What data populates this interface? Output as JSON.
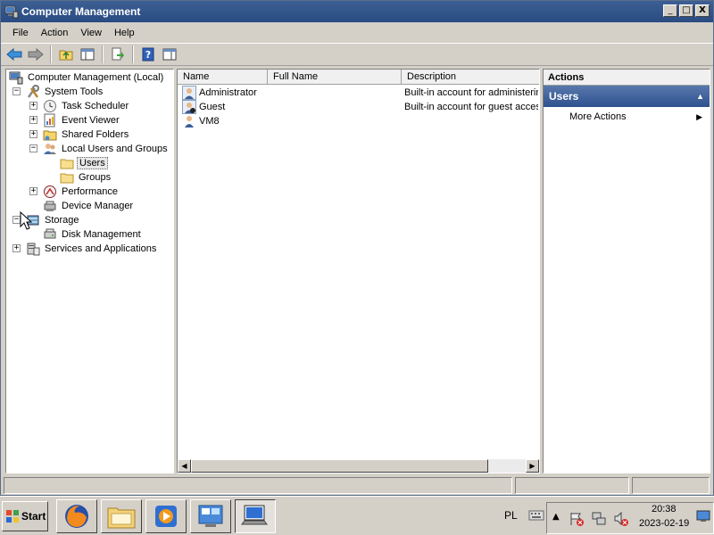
{
  "window": {
    "title": "Computer Management",
    "controls": {
      "minimize": "_",
      "maximize": "□",
      "close": "X"
    }
  },
  "menu": [
    "File",
    "Action",
    "View",
    "Help"
  ],
  "toolbar": [
    "back-arrow-icon",
    "forward-arrow-icon",
    "up-folder-icon",
    "show-hide-console-tree-icon",
    "export-list-icon",
    "help-icon",
    "show-hide-action-pane-icon"
  ],
  "tree": {
    "root": "Computer Management (Local)",
    "system_tools": "System Tools",
    "task_scheduler": "Task Scheduler",
    "event_viewer": "Event Viewer",
    "shared_folders": "Shared Folders",
    "local_users_groups": "Local Users and Groups",
    "users": "Users",
    "groups": "Groups",
    "performance": "Performance",
    "device_manager": "Device Manager",
    "storage": "Storage",
    "disk_management": "Disk Management",
    "services_apps": "Services and Applications",
    "expand_symbol": "+",
    "collapse_symbol": "−"
  },
  "list": {
    "columns": {
      "name": "Name",
      "full_name": "Full Name",
      "description": "Description"
    },
    "rows": [
      {
        "name": "Administrator",
        "full_name": "",
        "description": "Built-in account for administering..."
      },
      {
        "name": "Guest",
        "full_name": "",
        "description": "Built-in account for guest access..."
      },
      {
        "name": "VM8",
        "full_name": "",
        "description": ""
      }
    ]
  },
  "actions": {
    "header": "Actions",
    "section": "Users",
    "items": [
      "More Actions"
    ]
  },
  "taskbar": {
    "start": "Start",
    "apps": [
      "firefox-icon",
      "file-explorer-icon",
      "media-player-icon",
      "control-panel-icon",
      "computer-management-icon"
    ],
    "language": "PL",
    "time": "20:38",
    "date": "2023-02-19"
  },
  "colors": {
    "titlebar": "#284b82",
    "actions_section": "#2e5290",
    "chrome": "#d4d0c8"
  }
}
